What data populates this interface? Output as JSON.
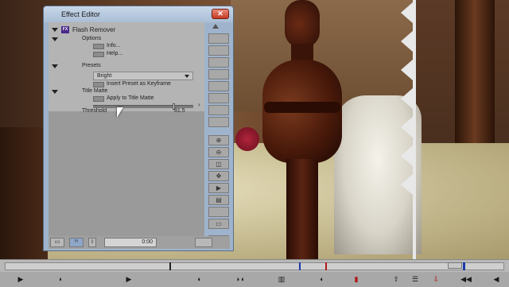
{
  "editor": {
    "title": "Effect Editor",
    "close_icon": "close-icon",
    "effect_name": "Flash Remover",
    "sections": {
      "options": "Options",
      "info": "Info...",
      "help": "Help...",
      "presets": "Presets",
      "preset_value": "Bright",
      "insert_preset": "Insert Preset as Keyframe",
      "title_matte": "Title Matte",
      "apply_title_matte": "Apply to Title Matte",
      "threshold": "Threshold",
      "threshold_value": "81.5"
    },
    "threshold_fraction": 0.815,
    "bottom": {
      "timecode": "0:00"
    }
  },
  "timeline": {
    "markers": [
      "blue",
      "red"
    ]
  },
  "colors": {
    "window_frame": "#9fb4cc",
    "panel": "#b4b4b4",
    "close_button": "#c43a22",
    "effect_badge": "#4a2a8a"
  }
}
